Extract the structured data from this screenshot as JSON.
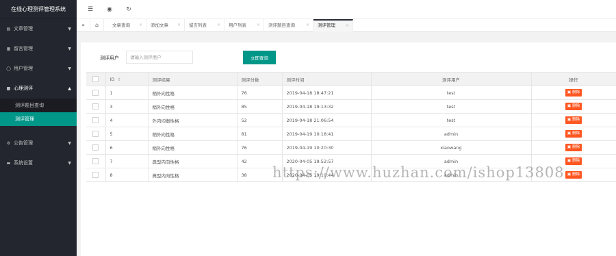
{
  "app": {
    "title": "在线心理测评管理系统"
  },
  "sidebar": {
    "items": [
      {
        "label": "文章管理",
        "icon": "book-icon"
      },
      {
        "label": "留言管理",
        "icon": "comment-icon"
      },
      {
        "label": "用户管理",
        "icon": "user-icon"
      },
      {
        "label": "心理测评",
        "icon": "list-icon",
        "open": true,
        "children": [
          {
            "label": "测评题目查询"
          },
          {
            "label": "测评管理",
            "active": true
          }
        ]
      },
      {
        "label": "公告管理",
        "icon": "gear-icon"
      },
      {
        "label": "系统设置",
        "icon": "monitor-icon"
      }
    ]
  },
  "header": {
    "buttons": [
      "menu-icon",
      "globe-icon",
      "refresh-icon"
    ]
  },
  "tabs": [
    {
      "label": "文章查询"
    },
    {
      "label": "添加文章"
    },
    {
      "label": "留言列表"
    },
    {
      "label": "用户列表"
    },
    {
      "label": "测评题目查询"
    },
    {
      "label": "测评管理",
      "active": true
    }
  ],
  "search": {
    "label": "测评用户",
    "placeholder": "请输入测评用户",
    "button": "立即查询"
  },
  "table": {
    "columns": [
      "ID",
      "测评结果",
      "测评分数",
      "测评时间",
      "测评用户",
      "操作"
    ],
    "delete_label": "删除",
    "rows": [
      [
        "1",
        "稍外向性格",
        "76",
        "2019-04-18 18:47:21",
        "test"
      ],
      [
        "3",
        "稍外向性格",
        "85",
        "2019-04-18 19:13:32",
        "test"
      ],
      [
        "4",
        "外内均衡性格",
        "52",
        "2019-04-18 21:06:54",
        "test"
      ],
      [
        "5",
        "稍外向性格",
        "81",
        "2019-04-19 10:18:41",
        "admin"
      ],
      [
        "6",
        "稍外向性格",
        "76",
        "2019-04-19 10:20:30",
        "xiaowang"
      ],
      [
        "7",
        "典型内向性格",
        "42",
        "2020-04-05 19:52:57",
        "admin"
      ],
      [
        "8",
        "典型内向性格",
        "38",
        "2020-04-05 19:10:44",
        "admin"
      ]
    ]
  },
  "watermark": "https://www.huzhan.com/ishop13808",
  "colors": {
    "sidebar": "#23262e",
    "accent": "#009688",
    "danger": "#ff5722"
  }
}
